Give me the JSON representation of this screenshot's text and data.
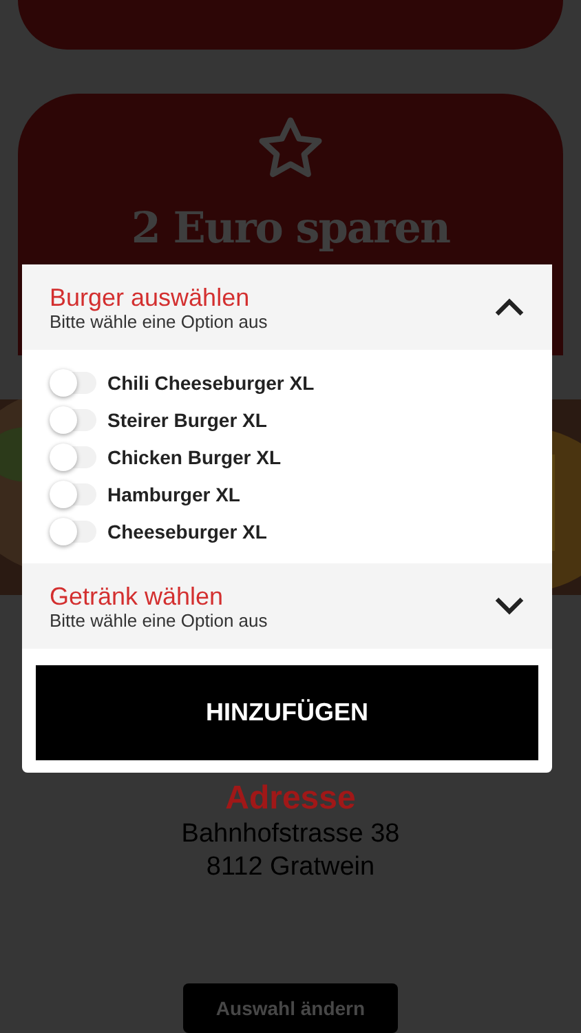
{
  "promo": {
    "title": "2 Euro sparen"
  },
  "address": {
    "heading": "Adresse",
    "lines": [
      "Bahnhofstrasse 38",
      "8112 Gratwein"
    ]
  },
  "change_button": "Auswahl ändern",
  "dialog": {
    "sections": [
      {
        "title": "Burger auswählen",
        "hint": "Bitte wähle eine Option aus",
        "expanded": true,
        "options": [
          {
            "label": "Chili Cheeseburger XL",
            "checked": false
          },
          {
            "label": "Steirer Burger XL",
            "checked": false
          },
          {
            "label": "Chicken Burger XL",
            "checked": false
          },
          {
            "label": "Hamburger XL",
            "checked": false
          },
          {
            "label": "Cheeseburger XL",
            "checked": false
          }
        ]
      },
      {
        "title": "Getränk wählen",
        "hint": "Bitte wähle eine Option aus",
        "expanded": false
      }
    ],
    "button": "HINZUFÜGEN"
  }
}
